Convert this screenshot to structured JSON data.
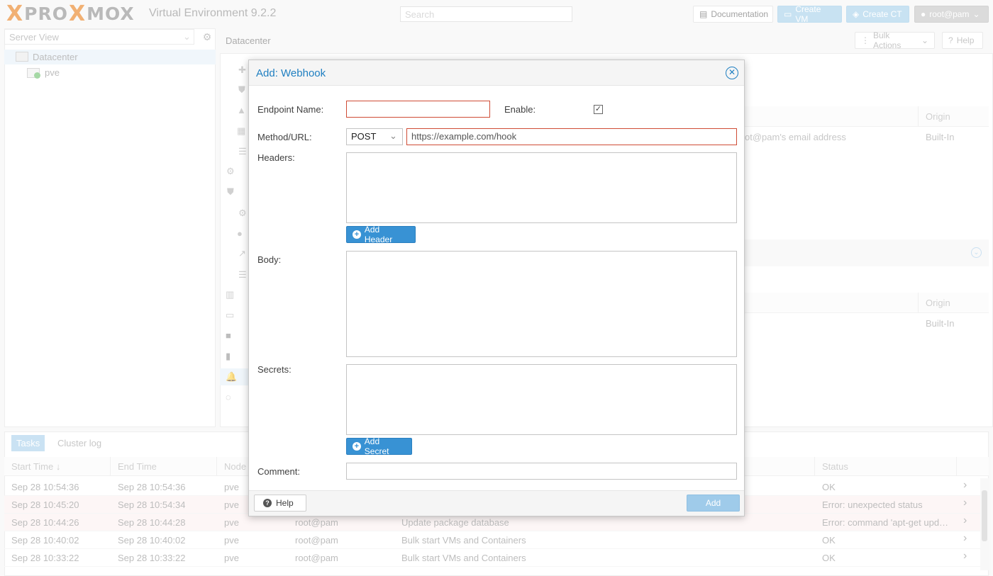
{
  "app": {
    "logo": "PROXMOX",
    "version": "Virtual Environment 9.2.2"
  },
  "topbar": {
    "search_placeholder": "Search",
    "documentation": "Documentation",
    "create_vm": "Create VM",
    "create_ct": "Create CT",
    "user": "root@pam"
  },
  "left": {
    "view": "Server View",
    "tree": [
      "Datacenter",
      "pve"
    ]
  },
  "main": {
    "title": "Datacenter",
    "bulk_actions": "Bulk Actions",
    "help": "Help",
    "grid1": {
      "origin_header": "Origin",
      "row_comment": "ot@pam's email address",
      "row_origin": "Built-In"
    },
    "grid2": {
      "origin_header": "Origin",
      "row_origin": "Built-In"
    }
  },
  "tasks": {
    "tabs": [
      "Tasks",
      "Cluster log"
    ],
    "columns": [
      "Start Time",
      "End Time",
      "Node",
      "Status"
    ],
    "rows": [
      {
        "start": "Sep 28 10:54:36",
        "end": "Sep 28 10:54:36",
        "node": "pve",
        "user": "",
        "desc": "",
        "status": "OK",
        "error": false
      },
      {
        "start": "Sep 28 10:45:20",
        "end": "Sep 28 10:54:34",
        "node": "pve",
        "user": "",
        "desc": "",
        "status": "Error: unexpected status",
        "error": true
      },
      {
        "start": "Sep 28 10:44:26",
        "end": "Sep 28 10:44:28",
        "node": "pve",
        "user": "root@pam",
        "desc": "Update package database",
        "status": "Error: command 'apt-get upd…",
        "error": true
      },
      {
        "start": "Sep 28 10:40:02",
        "end": "Sep 28 10:40:02",
        "node": "pve",
        "user": "root@pam",
        "desc": "Bulk start VMs and Containers",
        "status": "OK",
        "error": false
      },
      {
        "start": "Sep 28 10:33:22",
        "end": "Sep 28 10:33:22",
        "node": "pve",
        "user": "root@pam",
        "desc": "Bulk start VMs and Containers",
        "status": "OK",
        "error": false
      }
    ]
  },
  "dialog": {
    "title": "Add: Webhook",
    "endpoint_label": "Endpoint Name:",
    "endpoint_value": "",
    "enable_label": "Enable:",
    "method_label": "Method/URL:",
    "method_value": "POST",
    "url_value": "https://example.com/hook",
    "headers_label": "Headers:",
    "add_header": "Add Header",
    "body_label": "Body:",
    "secrets_label": "Secrets:",
    "add_secret": "Add Secret",
    "comment_label": "Comment:",
    "help": "Help",
    "add": "Add"
  }
}
